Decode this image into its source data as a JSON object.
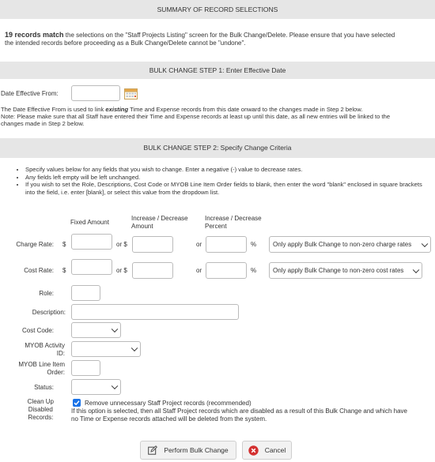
{
  "summary": {
    "heading": "SUMMARY OF RECORD SELECTIONS",
    "count_text": "19 records match",
    "message_1": " the selections on the \"Staff Projects Listing\" screen for the Bulk Change/Delete.  Please ensure that you have selected",
    "message_2": "the intended records before proceeding as a Bulk Change/Delete cannot be \"undone\"."
  },
  "step1": {
    "heading": "BULK CHANGE STEP 1: Enter Effective Date",
    "date_label": "Date Effective From:",
    "date_value": "",
    "note_1_pre": "The Date Effective From is used to link ",
    "note_1_em": "existing",
    "note_1_post": " Time and Expense records from this date onward to the changes made in Step 2 below.",
    "note_2": "Note: Please make sure that all Staff have entered their Time and Expense records at least up until this date, as all new entries will be linked to the",
    "note_3": "changes made in Step 2 below."
  },
  "step2": {
    "heading": "BULK CHANGE STEP 2: Specify Change Criteria",
    "bullets": [
      "Specify values below for any fields that you wish to change.  Enter a negative (-) value to decrease rates.",
      "Any fields left empty will be left unchanged.",
      "If you wish to set the Role, Descriptions, Cost Code or MYOB Line Item Order fields to blank, then enter the word \"blank\" enclosed in square brackets into the field, i.e. enter [blank], or select this value from the dropdown list."
    ],
    "col_fixed": "Fixed Amount",
    "col_incdec_amount_1": "Increase / Decrease",
    "col_incdec_amount_2": "Amount",
    "col_incdec_pct_1": "Increase / Decrease",
    "col_incdec_pct_2": "Percent",
    "charge_label": "Charge Rate:",
    "cost_label": "Cost Rate:",
    "currency": "$",
    "or_currency": "or $",
    "or": "or",
    "percent": "%",
    "charge_option": "Only apply Bulk Change to non-zero charge rates",
    "cost_option": "Only apply Bulk Change to non-zero cost rates",
    "role_label": "Role:",
    "desc_label": "Description:",
    "costcode_label": "Cost Code:",
    "myob_activity_label_1": "MYOB Activity",
    "myob_activity_label_2": "ID:",
    "myob_line_label_1": "MYOB Line Item",
    "myob_line_label_2": "Order:",
    "status_label": "Status:",
    "cleanup_label_1": "Clean Up",
    "cleanup_label_2": "Disabled",
    "cleanup_label_3": "Records:",
    "cleanup_checked": true,
    "cleanup_option": "Remove unnecessary Staff Project records (recommended)",
    "cleanup_note_1": "If this option is selected, then all Staff Project records which are disabled as a result of this Bulk Change and which have",
    "cleanup_note_2": "no Time or Expense records attached will be deleted from the system."
  },
  "actions": {
    "perform_label": "Perform Bulk Change",
    "cancel_label": "Cancel"
  },
  "icons": {
    "calendar": "calendar-icon",
    "edit": "edit-icon",
    "cancel": "cancel-icon"
  },
  "colors": {
    "section_header": "#e6e6e6",
    "checkbox": "#1a73e8",
    "cancel_icon": "#d32f2f"
  }
}
